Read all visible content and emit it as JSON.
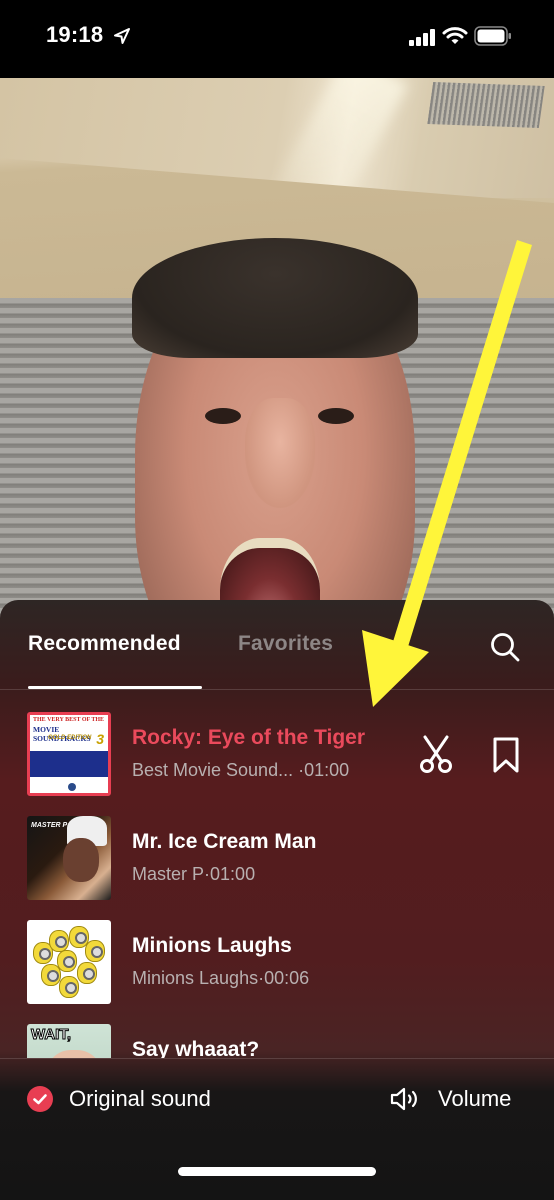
{
  "status_bar": {
    "time": "19:18",
    "icons": [
      "location-arrow-icon",
      "cellular-signal-icon",
      "wifi-icon",
      "battery-icon"
    ]
  },
  "camera": {
    "description": "front camera preview of man with open mouth"
  },
  "annotation": {
    "type": "yellow-arrow",
    "color": "#FFF53A",
    "points_to": "Rocky: Eye of the Tiger"
  },
  "sound_panel": {
    "tabs": [
      {
        "label": "Recommended",
        "active": true
      },
      {
        "label": "Favorites",
        "active": false
      }
    ],
    "search_icon": "search-icon",
    "tracks": [
      {
        "title": "Rocky: Eye of the Tiger",
        "artist": "Best Movie Sound...",
        "duration": "01:00",
        "selected": true,
        "thumb_text": [
          "THE VERY BEST OF THE",
          "MOVIE SOUNDTRACKS",
          "GOLD EDITION",
          "3"
        ]
      },
      {
        "title": "Mr. Ice Cream Man",
        "artist": "Master P",
        "duration": "01:00",
        "selected": false,
        "thumb_text": [
          "MASTER P"
        ]
      },
      {
        "title": "Minions Laughs",
        "artist": "Minions Laughs",
        "duration": "00:06",
        "selected": false
      },
      {
        "title": "Say whaaat?",
        "artist": "",
        "duration": "",
        "selected": false,
        "thumb_text": [
          "WAIT,"
        ]
      }
    ],
    "separator": "·",
    "selected_actions": [
      "scissors-icon",
      "bookmark-icon"
    ],
    "colors": {
      "accent": "#EA4A5C",
      "check": "#E83E52"
    }
  },
  "footer": {
    "original_sound": {
      "label": "Original sound",
      "checked": true
    },
    "volume": {
      "label": "Volume"
    }
  }
}
